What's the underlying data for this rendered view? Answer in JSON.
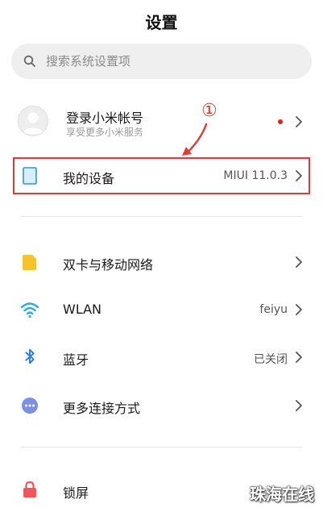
{
  "header": {
    "title": "设置"
  },
  "search": {
    "placeholder": "搜索系统设置项"
  },
  "account": {
    "name": "登录小米帐号",
    "subtitle": "享受更多小米服务"
  },
  "annotation": {
    "marker": "①",
    "color": "#e53935"
  },
  "items": [
    {
      "label": "我的设备",
      "value": "MIUI 11.0.3",
      "icon": "phone-device-icon"
    },
    {
      "label": "双卡与移动网络",
      "value": "",
      "icon": "sim-card-icon"
    },
    {
      "label": "WLAN",
      "value": "feiyu",
      "icon": "wifi-icon"
    },
    {
      "label": "蓝牙",
      "value": "已关闭",
      "icon": "bluetooth-icon"
    },
    {
      "label": "更多连接方式",
      "value": "",
      "icon": "more-connections-icon"
    },
    {
      "label": "锁屏",
      "value": "",
      "icon": "lock-icon"
    }
  ],
  "watermark": "珠海在线",
  "colors": {
    "search_bg": "#efefef",
    "highlight": "#e53935",
    "notification_dot": "#e02020",
    "sim_icon": "#f5c32c",
    "wifi_icon": "#2ba8e8",
    "bluetooth_icon": "#2f7fe0",
    "more_icon": "#7e8fe6",
    "lock_icon": "#f0575a"
  }
}
